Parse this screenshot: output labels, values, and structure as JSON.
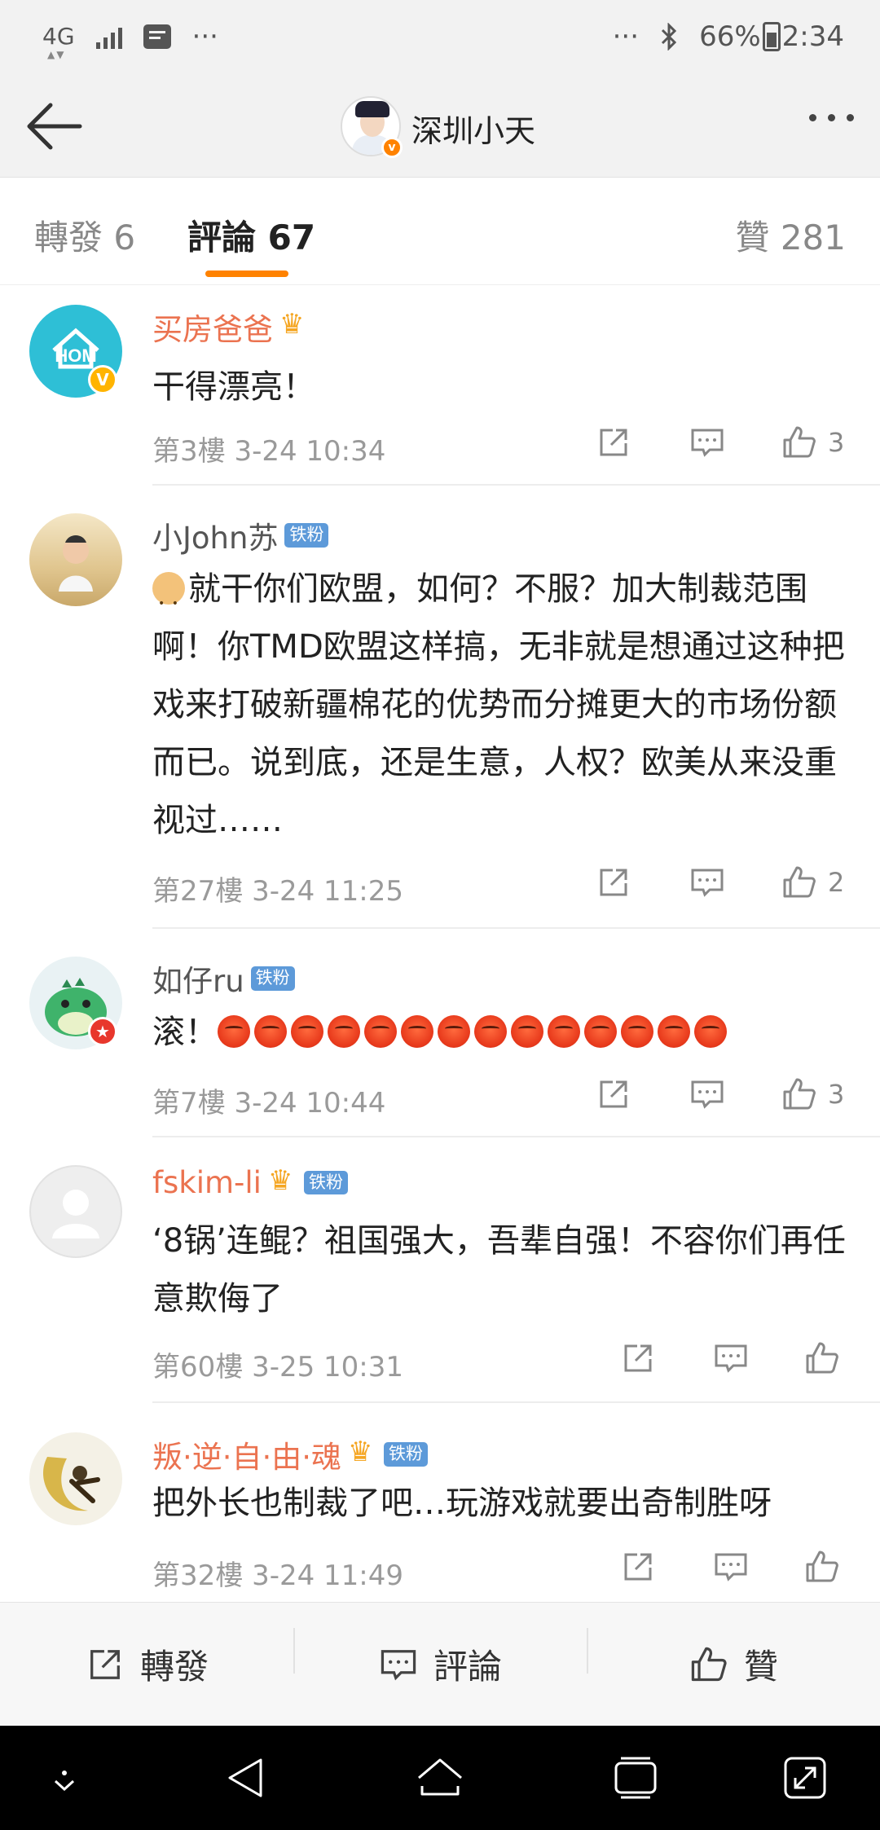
{
  "status_bar": {
    "network": "4G",
    "dots_left": "···",
    "dots_right": "···",
    "battery": "66%",
    "time": "2:34"
  },
  "header": {
    "title": "深圳小天",
    "back_icon": "arrow-left-icon",
    "more_icon": "more-dots-icon"
  },
  "tabs": {
    "repost": "轉發 6",
    "comments": "評論 67",
    "likes": "贊 281"
  },
  "comments": [
    {
      "name": "买房爸爸",
      "avatar": "home-logo",
      "badge_crown": true,
      "badge_fan": "",
      "text": "干得漂亮！",
      "meta": "第3樓 3-24 10:34",
      "likes": "3"
    },
    {
      "name": "小John苏",
      "avatar": "baby-photo",
      "badge_crown": false,
      "badge_fan": "铁粉",
      "text": "就干你们欧盟，如何？不服？加大制裁范围啊！你TMD欧盟这样搞，无非就是想通过这种把戏来打破新疆棉花的优势而分摊更大的市场份额而已。说到底，还是生意，人权？欧美从来没重视过……",
      "meta": "第27樓 3-24 11:25",
      "likes": "2"
    },
    {
      "name": "如仔ru",
      "avatar": "green-monster",
      "badge_crown": false,
      "badge_fan": "铁粉",
      "text": "滚！",
      "meta": "第7樓 3-24 10:44",
      "likes": "3"
    },
    {
      "name": "fskim-li",
      "avatar": "default-person",
      "badge_crown": true,
      "badge_fan": "铁粉",
      "text": "‘8锅’连鲲？祖国强大，吾辈自强！不容你们再任意欺侮了",
      "meta": "第60樓 3-25 10:31",
      "likes": ""
    },
    {
      "name": "叛·逆·自·由·魂",
      "avatar": "moon-warrior",
      "badge_crown": true,
      "badge_fan": "铁粉",
      "text": "把外长也制裁了吧…玩游戏就要出奇制胜呀",
      "meta": "第32樓 3-24 11:49",
      "likes": ""
    }
  ],
  "bottom_bar": {
    "repost": "轉發",
    "comment": "評論",
    "like": "贊"
  },
  "colors": {
    "accent": "#ff8200",
    "vip_name": "#eb7350",
    "fan_badge": "#5d9ad9"
  }
}
